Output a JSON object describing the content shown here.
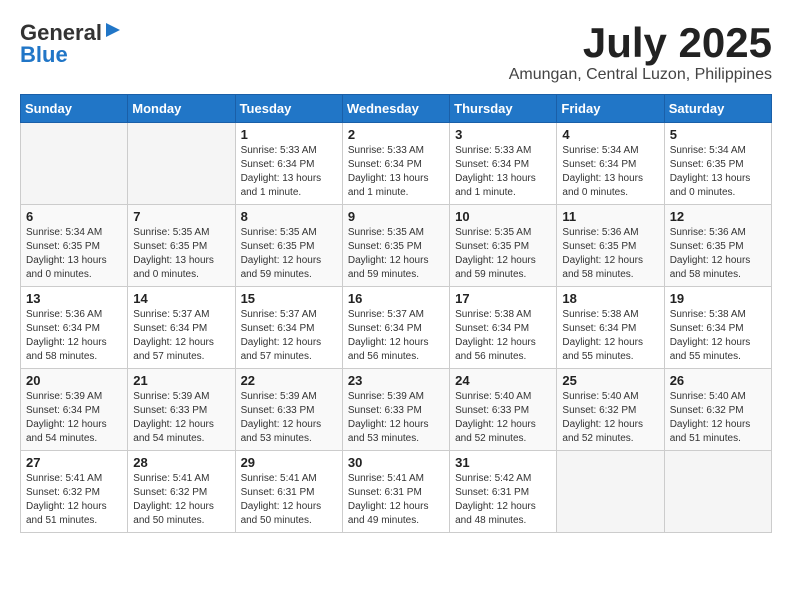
{
  "header": {
    "logo_general": "General",
    "logo_blue": "Blue",
    "title": "July 2025",
    "subtitle": "Amungan, Central Luzon, Philippines"
  },
  "weekdays": [
    "Sunday",
    "Monday",
    "Tuesday",
    "Wednesday",
    "Thursday",
    "Friday",
    "Saturday"
  ],
  "weeks": [
    [
      {
        "day": "",
        "sunrise": "",
        "sunset": "",
        "daylight": ""
      },
      {
        "day": "",
        "sunrise": "",
        "sunset": "",
        "daylight": ""
      },
      {
        "day": "1",
        "sunrise": "Sunrise: 5:33 AM",
        "sunset": "Sunset: 6:34 PM",
        "daylight": "Daylight: 13 hours and 1 minute."
      },
      {
        "day": "2",
        "sunrise": "Sunrise: 5:33 AM",
        "sunset": "Sunset: 6:34 PM",
        "daylight": "Daylight: 13 hours and 1 minute."
      },
      {
        "day": "3",
        "sunrise": "Sunrise: 5:33 AM",
        "sunset": "Sunset: 6:34 PM",
        "daylight": "Daylight: 13 hours and 1 minute."
      },
      {
        "day": "4",
        "sunrise": "Sunrise: 5:34 AM",
        "sunset": "Sunset: 6:34 PM",
        "daylight": "Daylight: 13 hours and 0 minutes."
      },
      {
        "day": "5",
        "sunrise": "Sunrise: 5:34 AM",
        "sunset": "Sunset: 6:35 PM",
        "daylight": "Daylight: 13 hours and 0 minutes."
      }
    ],
    [
      {
        "day": "6",
        "sunrise": "Sunrise: 5:34 AM",
        "sunset": "Sunset: 6:35 PM",
        "daylight": "Daylight: 13 hours and 0 minutes."
      },
      {
        "day": "7",
        "sunrise": "Sunrise: 5:35 AM",
        "sunset": "Sunset: 6:35 PM",
        "daylight": "Daylight: 13 hours and 0 minutes."
      },
      {
        "day": "8",
        "sunrise": "Sunrise: 5:35 AM",
        "sunset": "Sunset: 6:35 PM",
        "daylight": "Daylight: 12 hours and 59 minutes."
      },
      {
        "day": "9",
        "sunrise": "Sunrise: 5:35 AM",
        "sunset": "Sunset: 6:35 PM",
        "daylight": "Daylight: 12 hours and 59 minutes."
      },
      {
        "day": "10",
        "sunrise": "Sunrise: 5:35 AM",
        "sunset": "Sunset: 6:35 PM",
        "daylight": "Daylight: 12 hours and 59 minutes."
      },
      {
        "day": "11",
        "sunrise": "Sunrise: 5:36 AM",
        "sunset": "Sunset: 6:35 PM",
        "daylight": "Daylight: 12 hours and 58 minutes."
      },
      {
        "day": "12",
        "sunrise": "Sunrise: 5:36 AM",
        "sunset": "Sunset: 6:35 PM",
        "daylight": "Daylight: 12 hours and 58 minutes."
      }
    ],
    [
      {
        "day": "13",
        "sunrise": "Sunrise: 5:36 AM",
        "sunset": "Sunset: 6:34 PM",
        "daylight": "Daylight: 12 hours and 58 minutes."
      },
      {
        "day": "14",
        "sunrise": "Sunrise: 5:37 AM",
        "sunset": "Sunset: 6:34 PM",
        "daylight": "Daylight: 12 hours and 57 minutes."
      },
      {
        "day": "15",
        "sunrise": "Sunrise: 5:37 AM",
        "sunset": "Sunset: 6:34 PM",
        "daylight": "Daylight: 12 hours and 57 minutes."
      },
      {
        "day": "16",
        "sunrise": "Sunrise: 5:37 AM",
        "sunset": "Sunset: 6:34 PM",
        "daylight": "Daylight: 12 hours and 56 minutes."
      },
      {
        "day": "17",
        "sunrise": "Sunrise: 5:38 AM",
        "sunset": "Sunset: 6:34 PM",
        "daylight": "Daylight: 12 hours and 56 minutes."
      },
      {
        "day": "18",
        "sunrise": "Sunrise: 5:38 AM",
        "sunset": "Sunset: 6:34 PM",
        "daylight": "Daylight: 12 hours and 55 minutes."
      },
      {
        "day": "19",
        "sunrise": "Sunrise: 5:38 AM",
        "sunset": "Sunset: 6:34 PM",
        "daylight": "Daylight: 12 hours and 55 minutes."
      }
    ],
    [
      {
        "day": "20",
        "sunrise": "Sunrise: 5:39 AM",
        "sunset": "Sunset: 6:34 PM",
        "daylight": "Daylight: 12 hours and 54 minutes."
      },
      {
        "day": "21",
        "sunrise": "Sunrise: 5:39 AM",
        "sunset": "Sunset: 6:33 PM",
        "daylight": "Daylight: 12 hours and 54 minutes."
      },
      {
        "day": "22",
        "sunrise": "Sunrise: 5:39 AM",
        "sunset": "Sunset: 6:33 PM",
        "daylight": "Daylight: 12 hours and 53 minutes."
      },
      {
        "day": "23",
        "sunrise": "Sunrise: 5:39 AM",
        "sunset": "Sunset: 6:33 PM",
        "daylight": "Daylight: 12 hours and 53 minutes."
      },
      {
        "day": "24",
        "sunrise": "Sunrise: 5:40 AM",
        "sunset": "Sunset: 6:33 PM",
        "daylight": "Daylight: 12 hours and 52 minutes."
      },
      {
        "day": "25",
        "sunrise": "Sunrise: 5:40 AM",
        "sunset": "Sunset: 6:32 PM",
        "daylight": "Daylight: 12 hours and 52 minutes."
      },
      {
        "day": "26",
        "sunrise": "Sunrise: 5:40 AM",
        "sunset": "Sunset: 6:32 PM",
        "daylight": "Daylight: 12 hours and 51 minutes."
      }
    ],
    [
      {
        "day": "27",
        "sunrise": "Sunrise: 5:41 AM",
        "sunset": "Sunset: 6:32 PM",
        "daylight": "Daylight: 12 hours and 51 minutes."
      },
      {
        "day": "28",
        "sunrise": "Sunrise: 5:41 AM",
        "sunset": "Sunset: 6:32 PM",
        "daylight": "Daylight: 12 hours and 50 minutes."
      },
      {
        "day": "29",
        "sunrise": "Sunrise: 5:41 AM",
        "sunset": "Sunset: 6:31 PM",
        "daylight": "Daylight: 12 hours and 50 minutes."
      },
      {
        "day": "30",
        "sunrise": "Sunrise: 5:41 AM",
        "sunset": "Sunset: 6:31 PM",
        "daylight": "Daylight: 12 hours and 49 minutes."
      },
      {
        "day": "31",
        "sunrise": "Sunrise: 5:42 AM",
        "sunset": "Sunset: 6:31 PM",
        "daylight": "Daylight: 12 hours and 48 minutes."
      },
      {
        "day": "",
        "sunrise": "",
        "sunset": "",
        "daylight": ""
      },
      {
        "day": "",
        "sunrise": "",
        "sunset": "",
        "daylight": ""
      }
    ]
  ]
}
